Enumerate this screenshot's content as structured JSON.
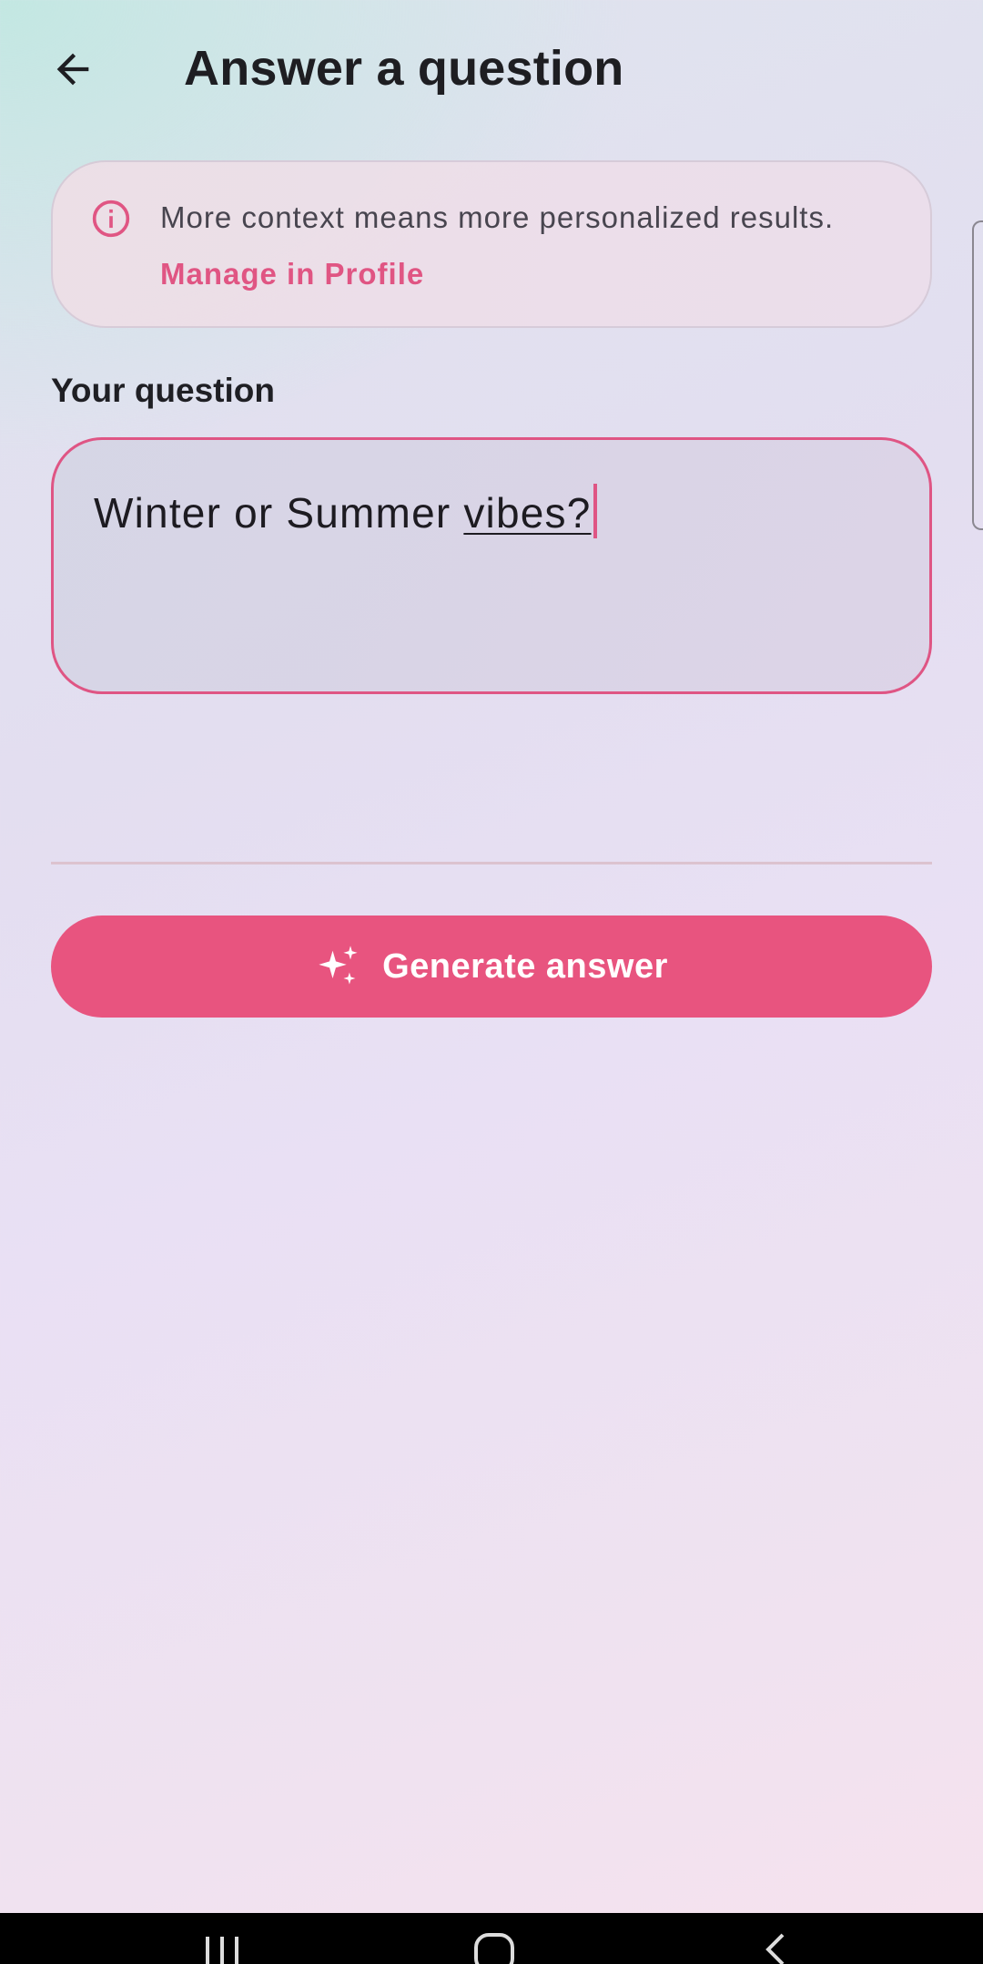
{
  "header": {
    "title": "Answer a question",
    "back_icon": "arrow-left-icon"
  },
  "info_card": {
    "icon": "info-icon",
    "message": "More context means more personalized results.",
    "link_label": "Manage in Profile"
  },
  "question": {
    "label": "Your question",
    "value_plain": "Winter or Summer ",
    "value_underlined": "vibes?"
  },
  "actions": {
    "generate_label": "Generate answer",
    "generate_icon": "sparkles-icon"
  },
  "colors": {
    "accent": "#e8547f",
    "text_primary": "#1e1e22",
    "link": "#e05583"
  }
}
